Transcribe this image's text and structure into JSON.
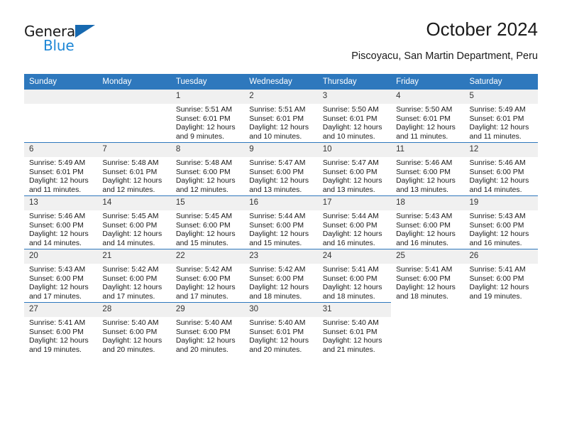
{
  "brand": {
    "name_top": "General",
    "name_bottom": "Blue",
    "triangle_color": "#1769b0",
    "blue_text_color": "#1e87d6"
  },
  "header": {
    "title": "October 2024",
    "subtitle": "Piscoyacu, San Martin Department, Peru"
  },
  "theme": {
    "header_bg": "#2e78bd",
    "header_text": "#ffffff",
    "daynum_bg": "#f0f0f0",
    "cell_bg": "#ffffff",
    "grid_line": "#2e78bd"
  },
  "weekdays": [
    "Sunday",
    "Monday",
    "Tuesday",
    "Wednesday",
    "Thursday",
    "Friday",
    "Saturday"
  ],
  "labels": {
    "sunrise_prefix": "Sunrise:",
    "sunset_prefix": "Sunset:",
    "daylight_prefix": "Daylight:"
  },
  "weeks": [
    [
      {
        "day": "",
        "blank": true
      },
      {
        "day": "",
        "blank": true
      },
      {
        "day": "1",
        "sunrise": "Sunrise: 5:51 AM",
        "sunset": "Sunset: 6:01 PM",
        "daylight": "Daylight: 12 hours and 9 minutes."
      },
      {
        "day": "2",
        "sunrise": "Sunrise: 5:51 AM",
        "sunset": "Sunset: 6:01 PM",
        "daylight": "Daylight: 12 hours and 10 minutes."
      },
      {
        "day": "3",
        "sunrise": "Sunrise: 5:50 AM",
        "sunset": "Sunset: 6:01 PM",
        "daylight": "Daylight: 12 hours and 10 minutes."
      },
      {
        "day": "4",
        "sunrise": "Sunrise: 5:50 AM",
        "sunset": "Sunset: 6:01 PM",
        "daylight": "Daylight: 12 hours and 11 minutes."
      },
      {
        "day": "5",
        "sunrise": "Sunrise: 5:49 AM",
        "sunset": "Sunset: 6:01 PM",
        "daylight": "Daylight: 12 hours and 11 minutes."
      }
    ],
    [
      {
        "day": "6",
        "sunrise": "Sunrise: 5:49 AM",
        "sunset": "Sunset: 6:01 PM",
        "daylight": "Daylight: 12 hours and 11 minutes."
      },
      {
        "day": "7",
        "sunrise": "Sunrise: 5:48 AM",
        "sunset": "Sunset: 6:01 PM",
        "daylight": "Daylight: 12 hours and 12 minutes."
      },
      {
        "day": "8",
        "sunrise": "Sunrise: 5:48 AM",
        "sunset": "Sunset: 6:00 PM",
        "daylight": "Daylight: 12 hours and 12 minutes."
      },
      {
        "day": "9",
        "sunrise": "Sunrise: 5:47 AM",
        "sunset": "Sunset: 6:00 PM",
        "daylight": "Daylight: 12 hours and 13 minutes."
      },
      {
        "day": "10",
        "sunrise": "Sunrise: 5:47 AM",
        "sunset": "Sunset: 6:00 PM",
        "daylight": "Daylight: 12 hours and 13 minutes."
      },
      {
        "day": "11",
        "sunrise": "Sunrise: 5:46 AM",
        "sunset": "Sunset: 6:00 PM",
        "daylight": "Daylight: 12 hours and 13 minutes."
      },
      {
        "day": "12",
        "sunrise": "Sunrise: 5:46 AM",
        "sunset": "Sunset: 6:00 PM",
        "daylight": "Daylight: 12 hours and 14 minutes."
      }
    ],
    [
      {
        "day": "13",
        "sunrise": "Sunrise: 5:46 AM",
        "sunset": "Sunset: 6:00 PM",
        "daylight": "Daylight: 12 hours and 14 minutes."
      },
      {
        "day": "14",
        "sunrise": "Sunrise: 5:45 AM",
        "sunset": "Sunset: 6:00 PM",
        "daylight": "Daylight: 12 hours and 14 minutes."
      },
      {
        "day": "15",
        "sunrise": "Sunrise: 5:45 AM",
        "sunset": "Sunset: 6:00 PM",
        "daylight": "Daylight: 12 hours and 15 minutes."
      },
      {
        "day": "16",
        "sunrise": "Sunrise: 5:44 AM",
        "sunset": "Sunset: 6:00 PM",
        "daylight": "Daylight: 12 hours and 15 minutes."
      },
      {
        "day": "17",
        "sunrise": "Sunrise: 5:44 AM",
        "sunset": "Sunset: 6:00 PM",
        "daylight": "Daylight: 12 hours and 16 minutes."
      },
      {
        "day": "18",
        "sunrise": "Sunrise: 5:43 AM",
        "sunset": "Sunset: 6:00 PM",
        "daylight": "Daylight: 12 hours and 16 minutes."
      },
      {
        "day": "19",
        "sunrise": "Sunrise: 5:43 AM",
        "sunset": "Sunset: 6:00 PM",
        "daylight": "Daylight: 12 hours and 16 minutes."
      }
    ],
    [
      {
        "day": "20",
        "sunrise": "Sunrise: 5:43 AM",
        "sunset": "Sunset: 6:00 PM",
        "daylight": "Daylight: 12 hours and 17 minutes."
      },
      {
        "day": "21",
        "sunrise": "Sunrise: 5:42 AM",
        "sunset": "Sunset: 6:00 PM",
        "daylight": "Daylight: 12 hours and 17 minutes."
      },
      {
        "day": "22",
        "sunrise": "Sunrise: 5:42 AM",
        "sunset": "Sunset: 6:00 PM",
        "daylight": "Daylight: 12 hours and 17 minutes."
      },
      {
        "day": "23",
        "sunrise": "Sunrise: 5:42 AM",
        "sunset": "Sunset: 6:00 PM",
        "daylight": "Daylight: 12 hours and 18 minutes."
      },
      {
        "day": "24",
        "sunrise": "Sunrise: 5:41 AM",
        "sunset": "Sunset: 6:00 PM",
        "daylight": "Daylight: 12 hours and 18 minutes."
      },
      {
        "day": "25",
        "sunrise": "Sunrise: 5:41 AM",
        "sunset": "Sunset: 6:00 PM",
        "daylight": "Daylight: 12 hours and 18 minutes."
      },
      {
        "day": "26",
        "sunrise": "Sunrise: 5:41 AM",
        "sunset": "Sunset: 6:00 PM",
        "daylight": "Daylight: 12 hours and 19 minutes."
      }
    ],
    [
      {
        "day": "27",
        "sunrise": "Sunrise: 5:41 AM",
        "sunset": "Sunset: 6:00 PM",
        "daylight": "Daylight: 12 hours and 19 minutes."
      },
      {
        "day": "28",
        "sunrise": "Sunrise: 5:40 AM",
        "sunset": "Sunset: 6:00 PM",
        "daylight": "Daylight: 12 hours and 20 minutes."
      },
      {
        "day": "29",
        "sunrise": "Sunrise: 5:40 AM",
        "sunset": "Sunset: 6:00 PM",
        "daylight": "Daylight: 12 hours and 20 minutes."
      },
      {
        "day": "30",
        "sunrise": "Sunrise: 5:40 AM",
        "sunset": "Sunset: 6:01 PM",
        "daylight": "Daylight: 12 hours and 20 minutes."
      },
      {
        "day": "31",
        "sunrise": "Sunrise: 5:40 AM",
        "sunset": "Sunset: 6:01 PM",
        "daylight": "Daylight: 12 hours and 21 minutes."
      },
      {
        "day": "",
        "blank": true,
        "nofill": true
      },
      {
        "day": "",
        "blank": true,
        "nofill": true
      }
    ]
  ]
}
